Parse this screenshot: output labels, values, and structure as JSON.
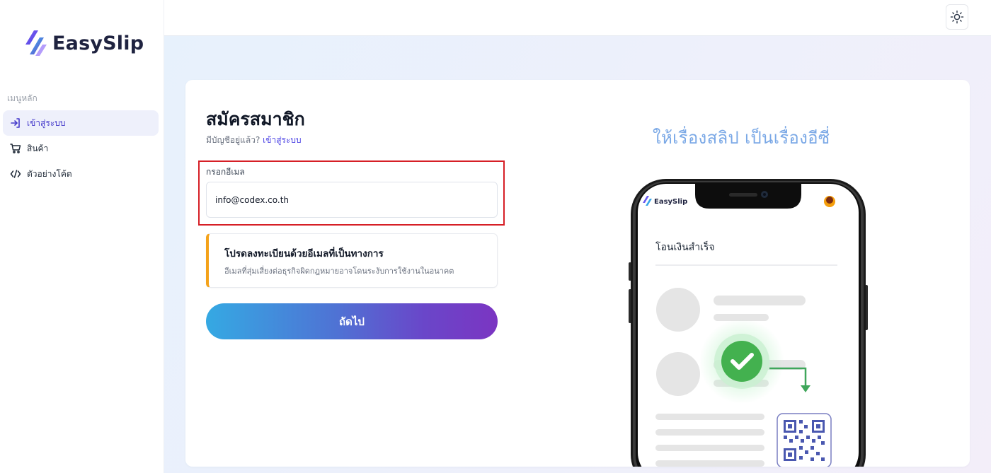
{
  "brand": {
    "name": "EasySlip"
  },
  "sidebar": {
    "heading": "เมนูหลัก",
    "items": [
      {
        "label": "เข้าสู่ระบบ",
        "icon": "login-icon",
        "active": true
      },
      {
        "label": "สินค้า",
        "icon": "cart-icon",
        "active": false
      },
      {
        "label": "ตัวอย่างโค้ด",
        "icon": "code-icon",
        "active": false
      }
    ]
  },
  "topbar": {
    "theme_icon": "sun-icon"
  },
  "form": {
    "title": "สมัครสมาชิก",
    "have_account": "มีบัญชีอยู่แล้ว?",
    "login_link": "เข้าสู่ระบบ",
    "email_label": "กรอกอีเมล",
    "email_value": "info@codex.co.th",
    "notice_title": "โปรดลงทะเบียนด้วยอีเมลที่เป็นทางการ",
    "notice_text": "อีเมลที่สุ่มเสี่ยงต่อธุรกิจผิดกฎหมายอาจโดนระงับการใช้งานในอนาคต",
    "next_label": "ถัดไป"
  },
  "promo": {
    "tagline": "ให้เรื่องสลิป เป็นเรื่องอีซี่",
    "phone_brand": "EasySlip",
    "phone_title": "โอนเงินสำเร็จ"
  },
  "colors": {
    "accent": "#4f46e5",
    "highlight": "#d61f26",
    "notice_bar": "#f4a21a",
    "button_start": "#35a9e3",
    "button_end": "#7b35c2",
    "success": "#4caf50"
  }
}
